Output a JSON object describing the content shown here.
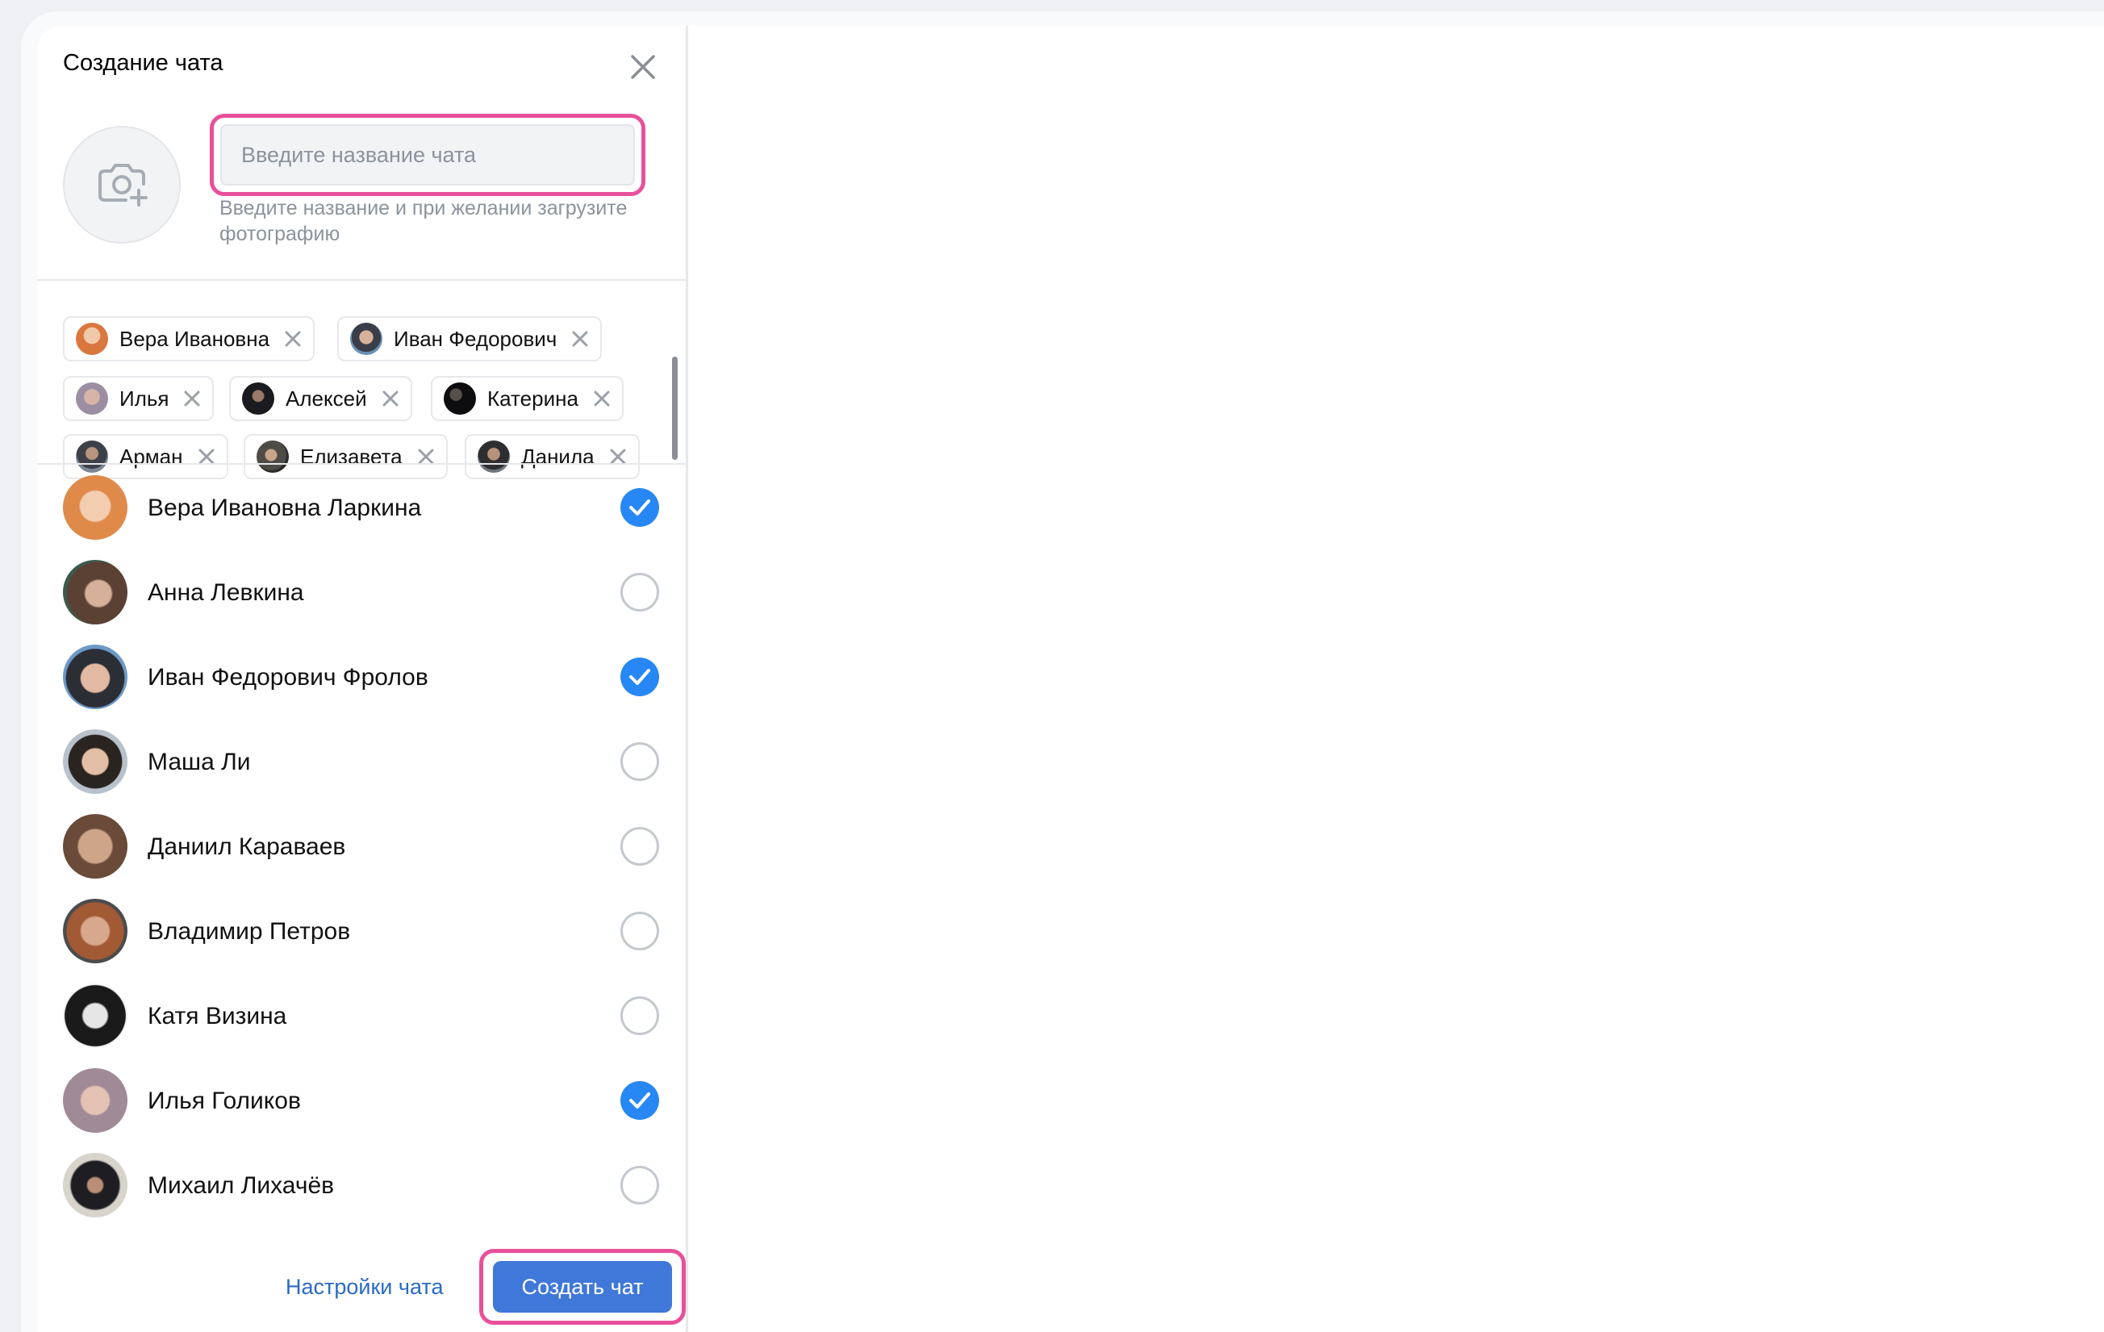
{
  "dialog": {
    "title": "Создание чата",
    "name_placeholder": "Введите название чата",
    "name_value": "",
    "hint": "Введите название и при желании загрузите фотографию",
    "settings_label": "Настройки чата",
    "create_label": "Создать чат"
  },
  "icons": {
    "close": "close-icon",
    "camera_add": "camera-add-icon",
    "remove": "remove-chip-icon",
    "check": "check-icon"
  },
  "colors": {
    "accent": "#2787f5",
    "button": "#3f78d8",
    "link": "#2a6ac6",
    "highlight": "#e8509a"
  },
  "selected_chips": [
    {
      "label": "Вера Ивановна"
    },
    {
      "label": "Иван Федорович"
    },
    {
      "label": "Илья"
    },
    {
      "label": "Алексей"
    },
    {
      "label": "Катерина"
    },
    {
      "label": "Арман"
    },
    {
      "label": "Елизавета"
    },
    {
      "label": "Данила"
    }
  ],
  "contacts": [
    {
      "name": "Вера Ивановна Ларкина",
      "selected": true
    },
    {
      "name": "Анна Левкина",
      "selected": false
    },
    {
      "name": "Иван Федорович Фролов",
      "selected": true
    },
    {
      "name": "Маша Ли",
      "selected": false
    },
    {
      "name": "Даниил Караваев",
      "selected": false
    },
    {
      "name": "Владимир Петров",
      "selected": false
    },
    {
      "name": "Катя Визина",
      "selected": false
    },
    {
      "name": "Илья Голиков",
      "selected": true
    },
    {
      "name": "Михаил Лихачёв",
      "selected": false
    }
  ]
}
